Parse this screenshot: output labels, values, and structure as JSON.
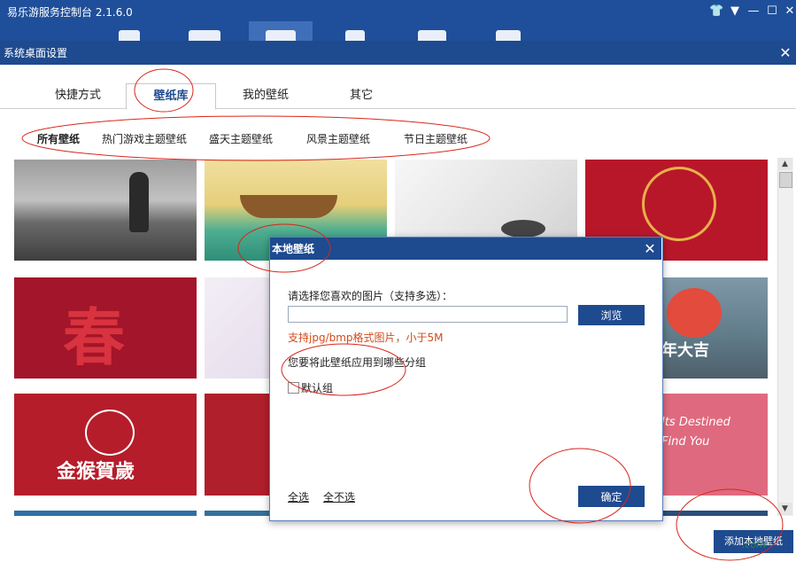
{
  "app": {
    "title": "易乐游服务控制台 2.1.6.0",
    "window_controls": [
      "👕",
      "▼",
      "—",
      "☐",
      "✕"
    ]
  },
  "settings": {
    "title": "系统桌面设置",
    "close": "✕",
    "tabs": [
      "快捷方式",
      "壁纸库",
      "我的壁纸",
      "其它"
    ],
    "active_tab": 1,
    "categories": [
      "所有壁纸",
      "热门游戏主题壁纸",
      "盛天主题壁纸",
      "风景主题壁纸",
      "节日主题壁纸"
    ],
    "active_category": 0
  },
  "wallpapers": [
    {
      "id": "soldier-field"
    },
    {
      "id": "boat-painting"
    },
    {
      "id": "ink-lotus"
    },
    {
      "id": "red-monkey-seal"
    },
    {
      "id": "chun-monkey",
      "text": "春"
    },
    {
      "id": "light-purple"
    },
    {
      "id": "dialog-hidden-1"
    },
    {
      "id": "lion-dance",
      "text": "年大吉"
    },
    {
      "id": "golden-monkey",
      "text": "金猴賀歲"
    },
    {
      "id": "red-plain"
    },
    {
      "id": "dialog-hidden-2"
    },
    {
      "id": "pink-valentine",
      "text": "Its Destined Find You"
    }
  ],
  "dialog": {
    "title": "本地壁纸",
    "close": "✕",
    "prompt": "请选择您喜欢的图片（支持多选）：",
    "path_value": "",
    "browse_label": "浏览",
    "format_note": "支持jpg/bmp格式图片，小于5M",
    "group_question": "您要将此壁纸应用到哪些分组",
    "groups": [
      {
        "label": "默认组",
        "checked": false
      }
    ],
    "select_all": "全选",
    "select_none": "全不选",
    "ok_label": "确定"
  },
  "add_local_label": "添加本地壁纸",
  "watermark": ".com",
  "scrollbar": {
    "up": "▲",
    "down": "▼"
  },
  "colors": {
    "brand": "#1e4a8f",
    "annotation": "#d9261c",
    "warning_text": "#d24b1a"
  }
}
